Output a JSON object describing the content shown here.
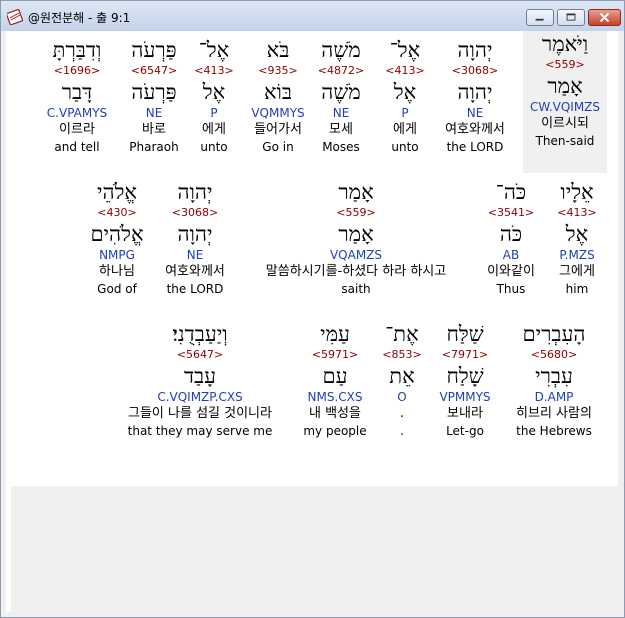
{
  "window": {
    "title": "@원전분해 - 출 9:1",
    "app_icon": "bible-book-icon",
    "controls": [
      "minimize-icon",
      "maximize-icon",
      "close-icon"
    ]
  },
  "rows": [
    [
      {
        "heb": "וַיֹּאמֶר",
        "strong": "<559>",
        "lemma": "אָמַר",
        "morph": "CW.VQIMZS",
        "kor": "이르시되",
        "eng": "Then-said"
      },
      {
        "heb": "יְהוָה",
        "strong": "<3068>",
        "lemma": "יְהוָה",
        "morph": "NE",
        "kor": "여호와께서",
        "eng": "the LORD"
      },
      {
        "heb": "אֶל־",
        "strong": "<413>",
        "lemma": "אֶל",
        "morph": "P",
        "kor": "에게",
        "eng": "unto"
      },
      {
        "heb": "מֹשֶׁה",
        "strong": "<4872>",
        "lemma": "מֹשֶׁה",
        "morph": "NE",
        "kor": "모세",
        "eng": "Moses"
      },
      {
        "heb": "בֹּא",
        "strong": "<935>",
        "lemma": "בּוֹא",
        "morph": "VQMMYS",
        "kor": "들어가서",
        "eng": "Go in"
      },
      {
        "heb": "אֶל־",
        "strong": "<413>",
        "lemma": "אֶל",
        "morph": "P",
        "kor": "에게",
        "eng": "unto"
      },
      {
        "heb": "פַּרְעֹה",
        "strong": "<6547>",
        "lemma": "פַּרְעֹה",
        "morph": "NE",
        "kor": "바로",
        "eng": "Pharaoh"
      },
      {
        "heb": "וְדִבַּרְתָּ",
        "strong": "<1696>",
        "lemma": "דָּבַר",
        "morph": "C.VPAMYS",
        "kor": "이르라",
        "eng": "and tell"
      }
    ],
    [
      {
        "heb": "אֵלָיו",
        "strong": "<413>",
        "lemma": "אֶל",
        "morph": "P.MZS",
        "kor": "그에게",
        "eng": "him"
      },
      {
        "heb": "כֹּה־",
        "strong": "<3541>",
        "lemma": "כֹּה",
        "morph": "AB",
        "kor": "이와같이",
        "eng": "Thus"
      },
      {
        "heb": "אָמַר",
        "strong": "<559>",
        "lemma": "אָמַר",
        "morph": "VQAMZS",
        "kor": "말씀하시기를-하셨다 하라 하시고",
        "eng": "saith"
      },
      {
        "heb": "יְהוָה",
        "strong": "<3068>",
        "lemma": "יְהוָה",
        "morph": "NE",
        "kor": "여호와께서",
        "eng": "the LORD"
      },
      {
        "heb": "אֱלֹהֵי",
        "strong": "<430>",
        "lemma": "אֱלֹהִים",
        "morph": "NMPG",
        "kor": "하나님",
        "eng": "God of"
      }
    ],
    [
      {
        "heb": "הָעִבְרִים",
        "strong": "<5680>",
        "lemma": "עִבְרִי",
        "morph": "D.AMP",
        "kor": "히브리 사람의",
        "eng": "the Hebrews"
      },
      {
        "heb": "שַׁלַּח",
        "strong": "<7971>",
        "lemma": "שָׁלַח",
        "morph": "VPMMYS",
        "kor": "보내라",
        "eng": "Let-go"
      },
      {
        "heb": "אֶת־",
        "strong": "<853>",
        "lemma": "אֵת",
        "morph": "O",
        "kor": ".",
        "eng": "."
      },
      {
        "heb": "עַמִּי",
        "strong": "<5971>",
        "lemma": "עַם",
        "morph": "NMS.CXS",
        "kor": "내 백성을",
        "eng": "my people"
      },
      {
        "heb": "וְיַעַבְדֻנִי׃",
        "strong": "<5647>",
        "lemma": "עָבַד",
        "morph": "C.VQIMZP.CXS",
        "kor": "그들이 나를 섬길 것이니라",
        "eng": "that they may serve me"
      }
    ]
  ]
}
